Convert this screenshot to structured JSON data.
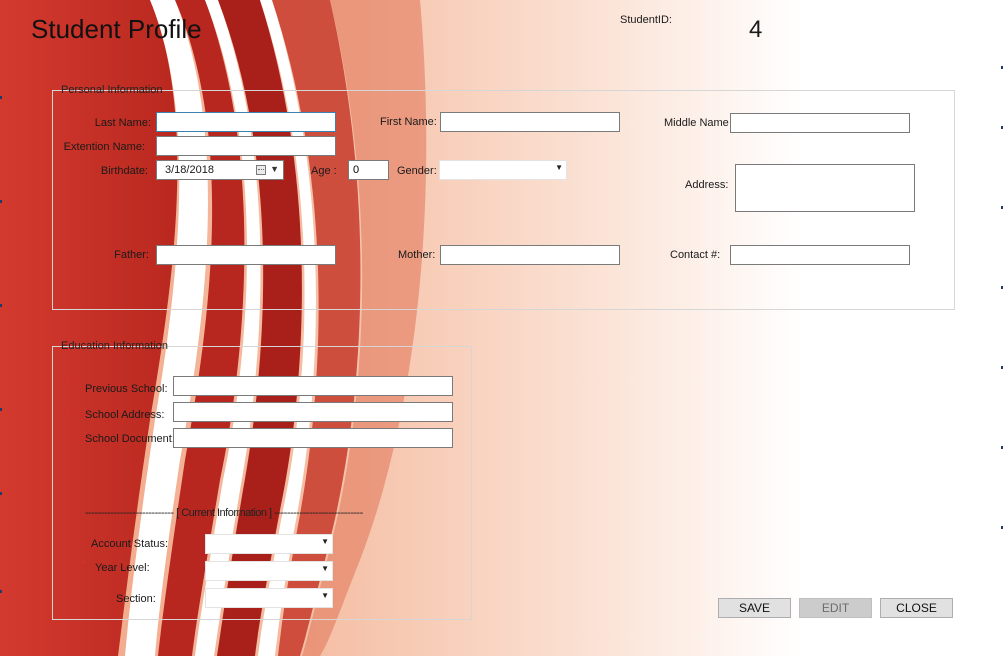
{
  "window": {
    "title": "Student Profile"
  },
  "student_id": {
    "label": "StudentID:",
    "value": "4"
  },
  "personal": {
    "legend": "Personal Information",
    "last_name": {
      "label": "Last Name:",
      "value": ""
    },
    "extension_name": {
      "label": "Extention Name:",
      "value": ""
    },
    "birthdate": {
      "label": "Birthdate:",
      "value": "3/18/2018"
    },
    "age": {
      "label": "Age :",
      "value": "0"
    },
    "gender": {
      "label": "Gender:",
      "value": ""
    },
    "first_name": {
      "label": "First Name:",
      "value": ""
    },
    "middle_name": {
      "label": "Middle Name",
      "value": ""
    },
    "address": {
      "label": "Address:",
      "value": ""
    },
    "father": {
      "label": "Father:",
      "value": ""
    },
    "mother": {
      "label": "Mother:",
      "value": ""
    },
    "contact": {
      "label": "Contact #:",
      "value": ""
    }
  },
  "education": {
    "legend": "Education Information",
    "required_marker": "*",
    "previous_school": {
      "label": "Previous School:",
      "value": ""
    },
    "school_address": {
      "label": "School Address:",
      "value": ""
    },
    "school_document": {
      "label": "School Document:",
      "value": ""
    },
    "current_separator": "---------------------------- [ Current Information ] ----------------------------",
    "account_status": {
      "label": "Account Status:",
      "value": ""
    },
    "year_level": {
      "label": "Year Level:",
      "value": ""
    },
    "section": {
      "label": "Section:",
      "value": ""
    }
  },
  "buttons": {
    "save": "SAVE",
    "edit": "EDIT",
    "close": "CLOSE"
  },
  "colors": {
    "accent_red": "#c8302a",
    "dark_red": "#9e1f1b",
    "button_face": "#e1e1e1",
    "button_disabled": "#cccccc"
  }
}
